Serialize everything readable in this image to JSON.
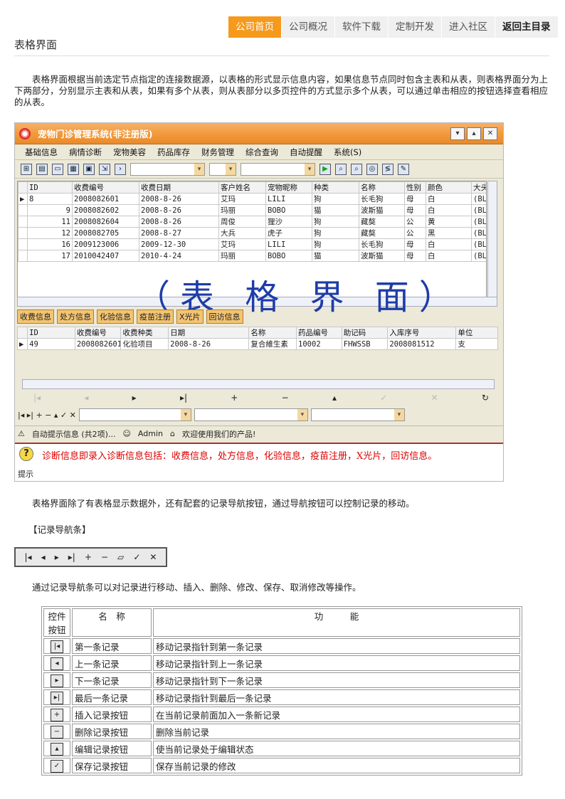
{
  "nav": {
    "tabs": [
      "公司首页",
      "公司概况",
      "软件下载",
      "定制开发",
      "进入社区",
      "返回主目录"
    ],
    "active": "公司首页"
  },
  "page_title": "表格界面",
  "intro": "表格界面根据当前选定节点指定的连接数据源，以表格的形式显示信息内容，如果信息节点同时包含主表和从表，则表格界面分为上下两部分，分别显示主表和从表，如果有多个从表，则从表部分以多页控件的方式显示多个从表，可以通过单击相应的按钮选择查看相应的从表。",
  "screenshot": {
    "window_title": "宠物门诊管理系统(非注册版)",
    "menu": [
      "基础信息",
      "病情诊断",
      "宠物美容",
      "药品库存",
      "财务管理",
      "综合查询",
      "自动提醒",
      "系统(S)"
    ],
    "main_columns": [
      "ID",
      "收费编号",
      "收费日期",
      "客户姓名",
      "宠物昵称",
      "种类",
      "名称",
      "性别",
      "颜色",
      "大头"
    ],
    "main_rows": [
      [
        "8",
        "2008082601",
        "2008-8-26",
        "艾玛",
        "LILI",
        "狗",
        "长毛狗",
        "母",
        "白",
        "(BL"
      ],
      [
        "9",
        "2008082602",
        "2008-8-26",
        "玛丽",
        "BOBO",
        "猫",
        "波斯猫",
        "母",
        "白",
        "(BL"
      ],
      [
        "11",
        "2008082604",
        "2008-8-26",
        "周俊",
        "狸沙",
        "狗",
        "藏獒",
        "公",
        "黄",
        "(BL"
      ],
      [
        "12",
        "2008082705",
        "2008-8-27",
        "大兵",
        "虎子",
        "狗",
        "藏獒",
        "公",
        "黑",
        "(BL"
      ],
      [
        "16",
        "2009123006",
        "2009-12-30",
        "艾玛",
        "LILI",
        "狗",
        "长毛狗",
        "母",
        "白",
        "(BL"
      ],
      [
        "17",
        "2010042407",
        "2010-4-24",
        "玛丽",
        "BOBO",
        "猫",
        "波斯猫",
        "母",
        "白",
        "(BL"
      ]
    ],
    "watermark": "（表 格 界 面）",
    "sub_tabs": [
      "收费信息",
      "处方信息",
      "化验信息",
      "疫苗注册",
      "X光片",
      "回访信息"
    ],
    "sub_columns": [
      "ID",
      "收费编号",
      "收费种类",
      "日期",
      "名称",
      "药品编号",
      "助记码",
      "入库序号",
      "单位"
    ],
    "sub_rows": [
      [
        "49",
        "2008082601",
        "化验项目",
        "2008-8-26",
        "复合維生素",
        "10002",
        "FHWSSB",
        "2008081512",
        "支"
      ]
    ],
    "nav_symbols": [
      "|◂",
      "◂",
      "▸",
      "▸|",
      "+",
      "−",
      "▴",
      "✓",
      "✕",
      "↻"
    ],
    "status_items": [
      "自动提示信息 (共2项)...",
      "Admin",
      "欢迎使用我们的产品!"
    ],
    "alert": "诊断信息即录入诊断信息包括：收费信息，处方信息，化验信息，疫苗注册，X光片，回访信息。",
    "alert_label": "提示"
  },
  "nav_desc": "表格界面除了有表格显示数据外，还有配套的记录导航按钮，通过导航按钮可以控制记录的移动。",
  "nav_heading": "【记录导航条】",
  "nav_buttons": [
    "|◂",
    "◂",
    "▸",
    "▸|",
    "+",
    "−",
    "▱",
    "✓",
    "✕"
  ],
  "ops_desc": "通过记录导航条可以对记录进行移动、插入、删除、修改、保存、取消修改等操作。",
  "table": {
    "headers": [
      "控件按钮",
      "名　称",
      "功　　　能"
    ],
    "rows": [
      {
        "icon": "|◂",
        "name": "第一条记录",
        "desc": "移动记录指针到第一条记录"
      },
      {
        "icon": "◂",
        "name": "上一条记录",
        "desc": "移动记录指针到上一条记录"
      },
      {
        "icon": "▸",
        "name": "下一条记录",
        "desc": "移动记录指针到下一条记录"
      },
      {
        "icon": "▸|",
        "name": "最后一条记录",
        "desc": "移动记录指针到最后一条记录"
      },
      {
        "icon": "+",
        "name": "插入记录按钮",
        "desc": "在当前记录前面加入一条新记录"
      },
      {
        "icon": "−",
        "name": "删除记录按钮",
        "desc": "删除当前记录"
      },
      {
        "icon": "▴",
        "name": "编辑记录按钮",
        "desc": "使当前记录处于编辑状态"
      },
      {
        "icon": "✓",
        "name": "保存记录按钮",
        "desc": "保存当前记录的修改"
      }
    ]
  }
}
